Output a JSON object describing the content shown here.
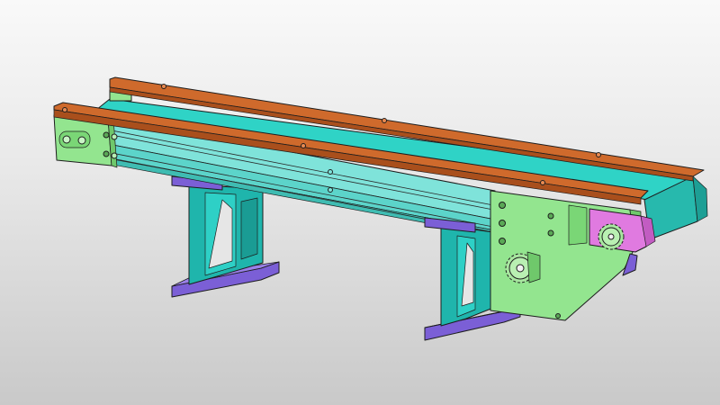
{
  "scene": {
    "subject": "belt-conveyor-assembly",
    "view": "isometric-3d-model",
    "colors": {
      "background_top": "#f9f9f9",
      "background_bottom": "#c9c9c9",
      "rail": "#cf6a2c",
      "belt": "#2fd3c6",
      "frame": "#8ae6de",
      "end_plate": "#93e58f",
      "leg": "#1fb5ac",
      "foot": "#7b5fd6",
      "guard": "#e07ae0",
      "sprocket": "#a8e6a0",
      "edge": "#1e1e1e"
    },
    "parts": [
      "guide-rail",
      "conveyor-belt",
      "side-frame",
      "drive-end-plate",
      "tail-end-plate",
      "support-leg",
      "foot-plate",
      "chain-guard",
      "drive-sprocket",
      "motor-shaft"
    ]
  }
}
